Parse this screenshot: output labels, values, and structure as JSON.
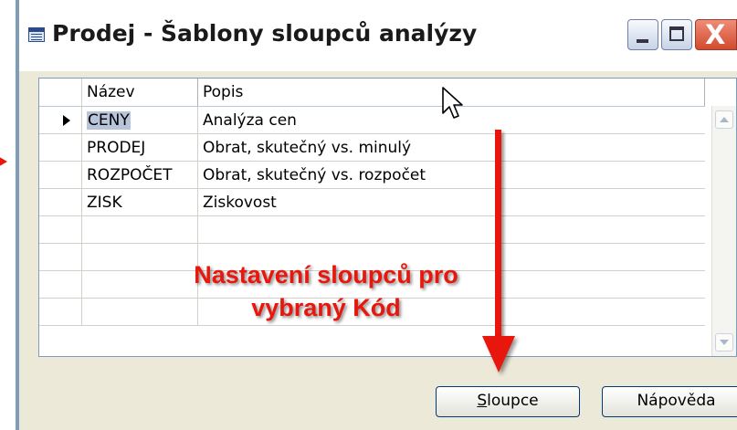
{
  "window": {
    "title": "Prodej - Šablony sloupců analýzy",
    "controls": {
      "minimize": "_",
      "maximize": "□",
      "close": "X"
    }
  },
  "grid": {
    "columns": [
      "Název",
      "Popis"
    ],
    "rows": [
      {
        "name": "CENY",
        "desc": "Analýza cen",
        "current": true
      },
      {
        "name": "PRODEJ",
        "desc": "Obrat, skutečný vs. minulý"
      },
      {
        "name": "ROZPOČET",
        "desc": "Obrat, skutečný vs. rozpočet"
      },
      {
        "name": "ZISK",
        "desc": "Ziskovost"
      },
      {
        "name": "",
        "desc": ""
      },
      {
        "name": "",
        "desc": ""
      },
      {
        "name": "",
        "desc": ""
      },
      {
        "name": "",
        "desc": ""
      }
    ]
  },
  "annotation": {
    "line1": "Nastavení sloupců pro",
    "line2": "vybraný Kód",
    "color": "#e8170d"
  },
  "buttons": {
    "sloupce": {
      "underline": "S",
      "rest": "loupce"
    },
    "napoveda": "Nápověda"
  },
  "icons": [
    "table-window-icon",
    "minimize-icon",
    "maximize-icon",
    "close-icon",
    "row-pointer-icon",
    "scroll-up-icon",
    "scroll-down-icon",
    "mouse-cursor-icon",
    "red-arrow-icon"
  ]
}
